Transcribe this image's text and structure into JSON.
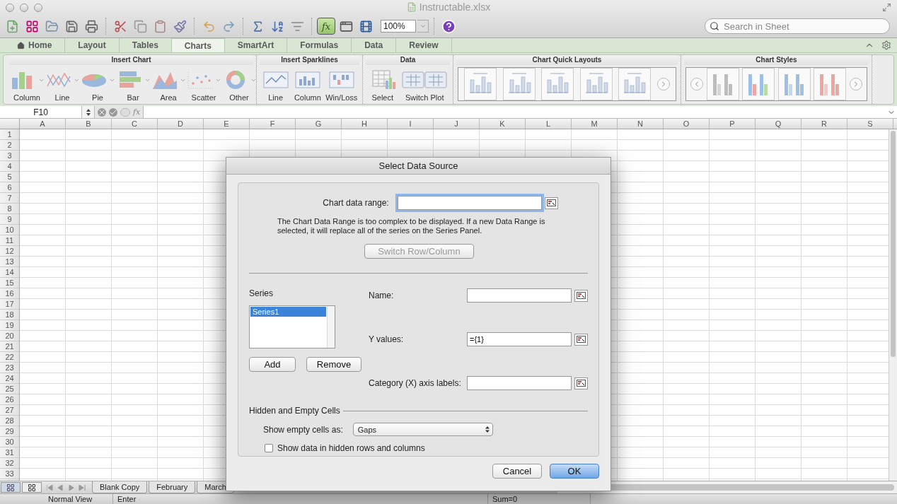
{
  "window": {
    "title": "Instructable.xlsx"
  },
  "toolbar": {
    "formula_builder": {
      "label": "fx",
      "on": true
    },
    "zoom": "100%",
    "search": {
      "placeholder": "Search in Sheet"
    }
  },
  "tabs": [
    {
      "label": "Home",
      "kind": "home",
      "selected": false
    },
    {
      "label": "Layout",
      "kind": "plain",
      "selected": false
    },
    {
      "label": "Tables",
      "kind": "plain",
      "selected": false
    },
    {
      "label": "Charts",
      "kind": "plain",
      "selected": true
    },
    {
      "label": "SmartArt",
      "kind": "plain",
      "selected": false
    },
    {
      "label": "Formulas",
      "kind": "plain",
      "selected": false
    },
    {
      "label": "Data",
      "kind": "plain",
      "selected": false
    },
    {
      "label": "Review",
      "kind": "plain",
      "selected": false
    }
  ],
  "ribbon": {
    "groups": [
      {
        "title": "Insert Chart",
        "kind": "buttons",
        "items": [
          {
            "label": "Column",
            "kind": "column",
            "menu": true
          },
          {
            "label": "Line",
            "kind": "line",
            "menu": true
          },
          {
            "label": "Pie",
            "kind": "pie",
            "menu": true
          },
          {
            "label": "Bar",
            "kind": "bar",
            "menu": true
          },
          {
            "label": "Area",
            "kind": "area",
            "menu": true
          },
          {
            "label": "Scatter",
            "kind": "scatter",
            "menu": true
          },
          {
            "label": "Other",
            "kind": "donut",
            "menu": true
          }
        ]
      },
      {
        "title": "Insert Sparklines",
        "kind": "buttons",
        "items": [
          {
            "label": "Line",
            "kind": "sparkline",
            "menu": false
          },
          {
            "label": "Column",
            "kind": "sparkcolumn",
            "menu": false
          },
          {
            "label": "Win/Loss",
            "kind": "winloss",
            "menu": false
          }
        ]
      },
      {
        "title": "Data",
        "kind": "buttons",
        "items": [
          {
            "label": "Select",
            "kind": "select",
            "menu": false
          },
          {
            "label": "Switch Plot",
            "kind": "switch",
            "menu": false
          }
        ]
      },
      {
        "title": "Chart Quick Layouts",
        "kind": "layouts"
      },
      {
        "title": "Chart Styles",
        "kind": "styles"
      }
    ]
  },
  "formula_bar": {
    "name_box": "F10",
    "function_label": "fx"
  },
  "sheet": {
    "columns": [
      "A",
      "B",
      "C",
      "D",
      "E",
      "F",
      "G",
      "H",
      "I",
      "J",
      "K",
      "L",
      "M",
      "N",
      "O",
      "P",
      "Q",
      "R",
      "S"
    ],
    "rows": [
      "1",
      "2",
      "3",
      "4",
      "5",
      "6",
      "7",
      "8",
      "9",
      "10",
      "11",
      "12",
      "13",
      "14",
      "15",
      "16",
      "17",
      "18",
      "19",
      "20",
      "21",
      "22",
      "23",
      "24",
      "25",
      "26",
      "27",
      "28",
      "29",
      "30",
      "31",
      "32",
      "33"
    ]
  },
  "sheet_tabs": [
    {
      "label": "Blank Copy",
      "selected": false
    },
    {
      "label": "February",
      "selected": false
    },
    {
      "label": "March",
      "selected": false
    }
  ],
  "status_bar": {
    "view": "Normal View",
    "mode": "Enter",
    "sum": "Sum=0"
  },
  "dialog": {
    "title": "Select Data Source",
    "data_range": {
      "label": "Chart data range:"
    },
    "message": "The Chart Data Range is too complex to be displayed. If a new Data Range is selected, it will replace all of the series on the Series Panel.",
    "switch_button": {
      "label": "Switch Row/Column",
      "disabled": true
    },
    "series": {
      "label": "Series",
      "items": [
        {
          "label": "Series1",
          "selected": true
        }
      ]
    },
    "add_button": "Add",
    "remove_button": "Remove",
    "fields": [
      {
        "label": "Name:"
      },
      {
        "label": "Y values:",
        "value": "={1}"
      },
      {
        "label": "Category (X) axis labels:"
      }
    ],
    "hidden_section": {
      "title": "Hidden and Empty Cells",
      "show_empty_label": "Show empty cells as:",
      "show_empty_value": "Gaps",
      "show_hidden": {
        "label": "Show data in hidden rows and columns",
        "checked": false
      }
    },
    "buttons": [
      {
        "label": "Cancel",
        "default": false
      },
      {
        "label": "OK",
        "default": true
      }
    ]
  }
}
